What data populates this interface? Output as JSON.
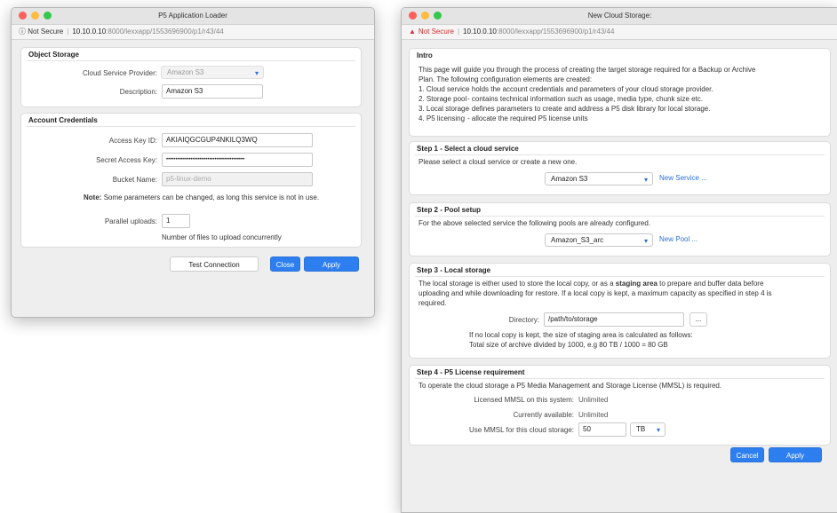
{
  "colors": {
    "accent": "#2d7ff0",
    "warning": "#d32f2f",
    "link": "#2a6fdb"
  },
  "left_window": {
    "title": "P5 Application Loader",
    "url": {
      "info_icon": "info-icon",
      "security": "Not Secure",
      "host": "10.10.0.10",
      "path": ":8000/lexxapp/1553696900/p1/r43/44"
    },
    "object_storage": {
      "heading": "Object Storage",
      "provider_label": "Cloud Service Provider:",
      "provider_value": "Amazon S3",
      "description_label": "Description:",
      "description_value": "Amazon S3"
    },
    "credentials": {
      "heading": "Account Credentials",
      "access_key_label": "Access Key ID:",
      "access_key_value": "AKIAIQGCGUP4NKILQ3WQ",
      "secret_key_label": "Secret Access Key:",
      "secret_key_value": "••••••••••••••••••••••••••••••••••••••••••",
      "bucket_label": "Bucket Name:",
      "bucket_value": "p5-linux-demo",
      "note_bold": "Note:",
      "note_text": "Some parameters can be changed, as long this service is not in use.",
      "parallel_label": "Parallel uploads:",
      "parallel_value": "1",
      "parallel_hint": "Number of files to upload concurrently"
    },
    "buttons": {
      "test": "Test Connection",
      "close": "Close",
      "apply": "Apply"
    }
  },
  "right_window": {
    "title": "New Cloud Storage:",
    "url": {
      "security": "Not Secure",
      "host": "10.10.0.10",
      "path": ":8000/lexxapp/1553696900/p1/r43/44"
    },
    "intro": {
      "heading": "Intro",
      "line1": "This page will guide you through the process of creating the target storage required for a Backup or Archive",
      "line2": "Plan. The following configuration elements are created:",
      "items": [
        {
          "key": "1. Cloud service",
          "desc": "- holds the account credentials and parameters of your cloud storage provider."
        },
        {
          "key": "2. Storage pool",
          "desc": "- contains technical information such as usage, media type, chunk size etc."
        },
        {
          "key": "3. Local storage",
          "desc": "- defines parameters to create and address a P5 disk library for local storage."
        },
        {
          "key": "4. P5 licensing",
          "desc": "- allocate the required P5 license units"
        }
      ]
    },
    "step1": {
      "heading": "Step 1 - Select a cloud service",
      "text": "Please select a cloud service or create a new one.",
      "select": "Amazon S3",
      "link": "New Service ..."
    },
    "step2": {
      "heading": "Step 2 - Pool setup",
      "text": "For the above selected service the following pools are already configured.",
      "select": "Amazon_S3_arc",
      "link": "New Pool ..."
    },
    "step3": {
      "heading": "Step 3 - Local storage",
      "line1a": "The local storage is either used to store the local copy, or as a ",
      "line1b": "staging area",
      "line1c": " to prepare and buffer data before",
      "line2": "uploading and while downloading for restore. If a local copy is kept, a maximum capacity as specified in step 4 is",
      "line3": "required.",
      "dir_label": "Directory:",
      "dir_value": "/path/to/storage",
      "browse": "...",
      "hint1": "If no local copy is kept, the size of staging area is calculated as follows:",
      "hint2": "Total size of archive divided by 1000, e.g 80 TB / 1000 = 80 GB"
    },
    "step4": {
      "heading": "Step 4 - P5 License requirement",
      "text": "To operate the cloud storage a P5 Media Management and Storage License (MMSL) is required.",
      "licensed_label": "Licensed MMSL on this system:",
      "licensed_value": "Unlimited",
      "available_label": "Currently available:",
      "available_value": "Unlimited",
      "use_label": "Use MMSL for this cloud storage:",
      "use_value": "50",
      "unit": "TB"
    },
    "buttons": {
      "cancel": "Cancel",
      "apply": "Apply"
    }
  }
}
